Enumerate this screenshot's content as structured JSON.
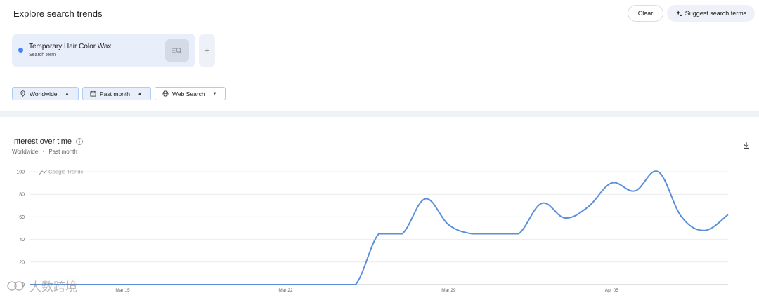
{
  "header": {
    "title": "Explore search trends",
    "clear_label": "Clear",
    "suggest_label": "Suggest search terms"
  },
  "term": {
    "name": "Temporary Hair Color Wax",
    "type": "Search term",
    "color": "#4285f4",
    "add_label": "+"
  },
  "filters": {
    "region": "Worldwide",
    "period": "Past month",
    "property": "Web Search"
  },
  "section": {
    "title": "Interest over time",
    "subtitle_region": "Worldwide",
    "subtitle_sep": "·",
    "subtitle_period": "Past month"
  },
  "chart_data": {
    "type": "line",
    "watermark_label": "Google Trends",
    "y_ticks": [
      0,
      20,
      40,
      60,
      80,
      100
    ],
    "ylim": [
      0,
      100
    ],
    "x_tick_labels": [
      {
        "label": "Mar 15",
        "index": 4
      },
      {
        "label": "Mar 22",
        "index": 11
      },
      {
        "label": "Mar 29",
        "index": 18
      },
      {
        "label": "Apr 05",
        "index": 25
      }
    ],
    "series": [
      {
        "color": "#5b8fd9",
        "values": [
          0,
          0,
          0,
          0,
          0,
          0,
          0,
          0,
          0,
          0,
          0,
          0,
          0,
          0,
          0,
          45,
          45,
          76,
          53,
          45,
          45,
          45,
          72,
          59,
          69,
          90,
          83,
          100,
          60,
          48,
          62
        ]
      }
    ]
  },
  "watermark": {
    "text": "大数跨境"
  }
}
